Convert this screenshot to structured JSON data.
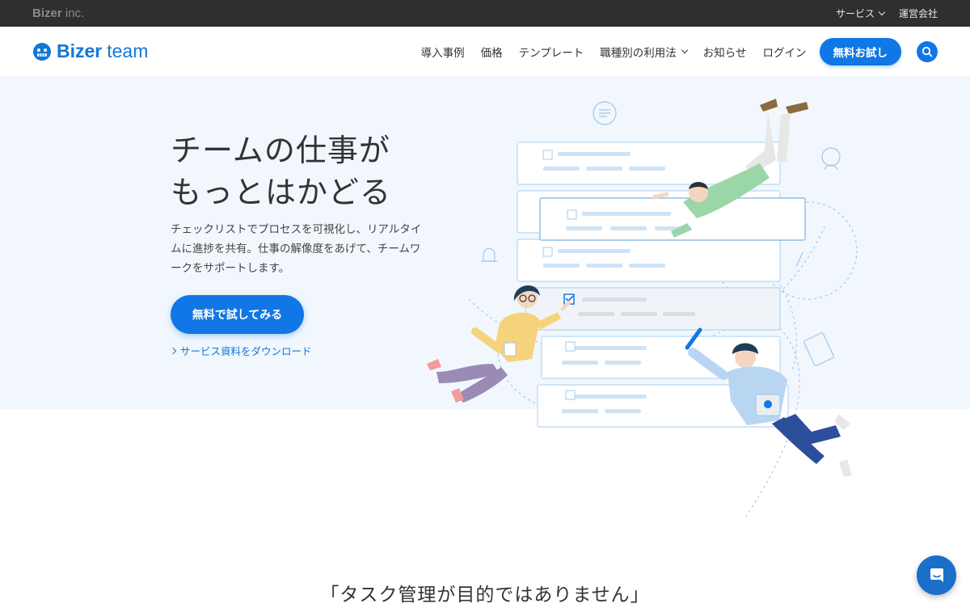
{
  "topbar": {
    "corp_logo_bold": "Bizer",
    "corp_logo_light": " inc.",
    "service_label": "サービス",
    "company_label": "運営会社"
  },
  "header": {
    "brand_bold": "Bizer",
    "brand_light": "team",
    "nav": {
      "cases": "導入事例",
      "pricing": "価格",
      "templates": "テンプレート",
      "by_role": "職種別の利用法",
      "news": "お知らせ",
      "login": "ログイン"
    },
    "trial_label": "無料お試し",
    "search_icon": "search-icon"
  },
  "hero": {
    "title_line1": "チームの仕事が",
    "title_line2": "もっとはかどる",
    "description": "チェックリストでプロセスを可視化し、リアルタイムに進捗を共有。仕事の解像度をあげて、チームワークをサポートします。",
    "cta_label": "無料で試してみる",
    "download_label": "サービス資料をダウンロード"
  },
  "section": {
    "quote": "「タスク管理が目的ではありません」"
  },
  "chat": {
    "icon": "chat-icon"
  },
  "colors": {
    "accent": "#1177e6",
    "hero_bg": "#f1f7fd",
    "topbar_bg": "#2f2f2f"
  }
}
